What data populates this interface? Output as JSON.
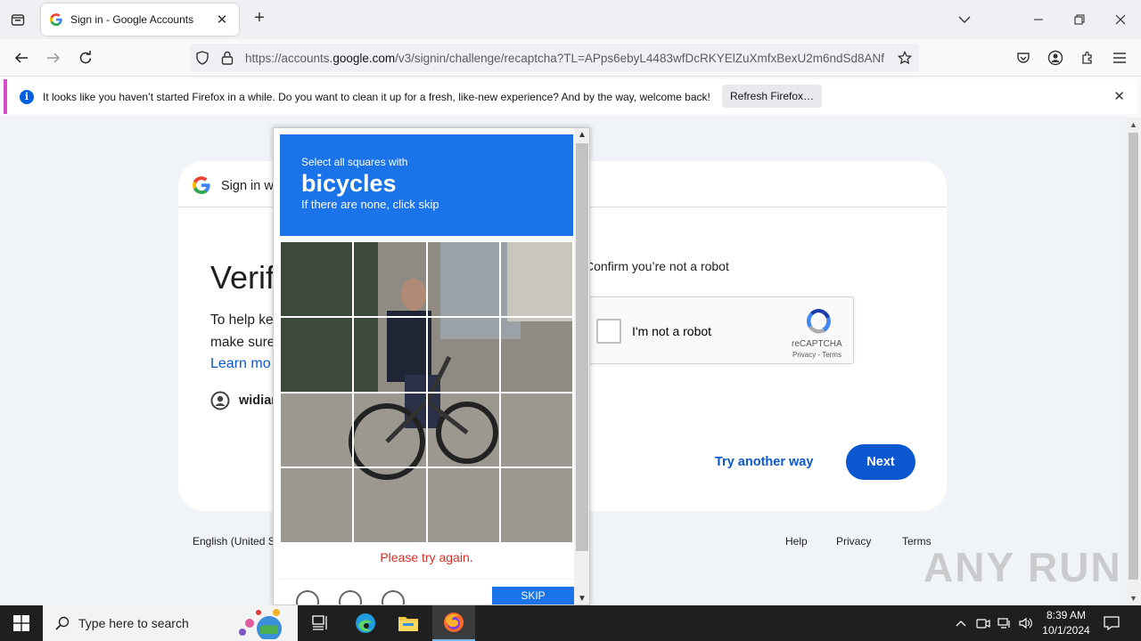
{
  "browser": {
    "tab_title": "Sign in - Google Accounts",
    "url_prefix": "https://accounts.",
    "url_domain": "google.com",
    "url_suffix": "/v3/signin/challenge/recaptcha?TL=APps6ebyL4483wfDcRKYElZuXmfxBexU2m6ndSd8ANf",
    "notification": "It looks like you haven’t started Firefox in a while. Do you want to clean it up for a fresh, like-new experience? And by the way, welcome back!",
    "refresh_button": "Refresh Firefox…"
  },
  "page": {
    "signin_label": "Sign in w",
    "heading": "Verif",
    "help_line1": "To help ke",
    "help_line2": "make sure",
    "learn_more": "Learn mo",
    "account_name": "widian",
    "confirm_text": "Confirm you’re not a robot",
    "checkbox_label": "I'm not a robot",
    "recaptcha_brand": "reCAPTCHA",
    "recaptcha_links": "Privacy - Terms",
    "try_another": "Try another way",
    "next": "Next",
    "footer_language": "English (United S",
    "footer_help": "Help",
    "footer_privacy": "Privacy",
    "footer_terms": "Terms"
  },
  "captcha": {
    "instruction": "Select all squares with",
    "target": "bicycles",
    "hint": "If there are none, click skip",
    "error": "Please try again.",
    "skip": "SKIP",
    "grid_size": 4
  },
  "watermark": "ANY RUN",
  "taskbar": {
    "search_placeholder": "Type here to search",
    "time": "8:39 AM",
    "date": "10/1/2024"
  },
  "colors": {
    "google_blue": "#0b57d0",
    "captcha_blue": "#1a73e8",
    "error_red": "#d93025",
    "notification_accent": "#d94cc9"
  }
}
